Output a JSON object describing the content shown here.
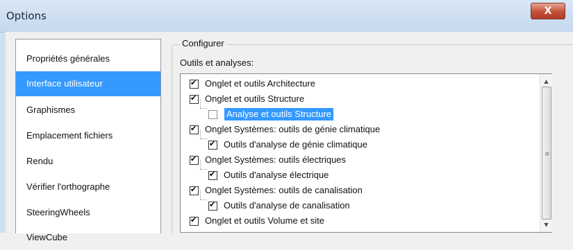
{
  "window": {
    "title": "Options",
    "close_label": "X"
  },
  "sidebar": {
    "items": [
      {
        "label": "Propriétés générales"
      },
      {
        "label": "Interface utilisateur",
        "selected": true
      },
      {
        "label": "Graphismes"
      },
      {
        "label": "Emplacement fichiers"
      },
      {
        "label": "Rendu"
      },
      {
        "label": "Vérifier l'orthographe"
      },
      {
        "label": "SteeringWheels"
      },
      {
        "label": "ViewCube"
      }
    ]
  },
  "configure": {
    "legend": "Configurer",
    "tools_label": "Outils et analyses:",
    "items": [
      {
        "label": "Onglet et outils Architecture",
        "checked": true
      },
      {
        "label": "Onglet et outils Structure",
        "checked": true
      },
      {
        "label": "Analyse et outils Structure",
        "checked": false,
        "highlighted": true
      },
      {
        "label": "Onglet Systèmes: outils de génie climatique",
        "checked": true
      },
      {
        "label": "Outils d'analyse de génie climatique",
        "checked": true
      },
      {
        "label": "Onglet Systèmes: outils électriques",
        "checked": true
      },
      {
        "label": "Outils d'analyse électrique",
        "checked": true
      },
      {
        "label": "Onglet Systèmes: outils de canalisation",
        "checked": true
      },
      {
        "label": "Outils d'analyse de canalisation",
        "checked": true
      },
      {
        "label": "Onglet et outils Volume et site",
        "checked": true
      }
    ]
  },
  "colors": {
    "selection": "#3399ff",
    "titlebar": "#c5d8ee",
    "close": "#c4513a"
  },
  "icons": {
    "close": "close-icon",
    "scroll_up": "triangle-up-icon",
    "scroll_down": "triangle-down-icon"
  }
}
